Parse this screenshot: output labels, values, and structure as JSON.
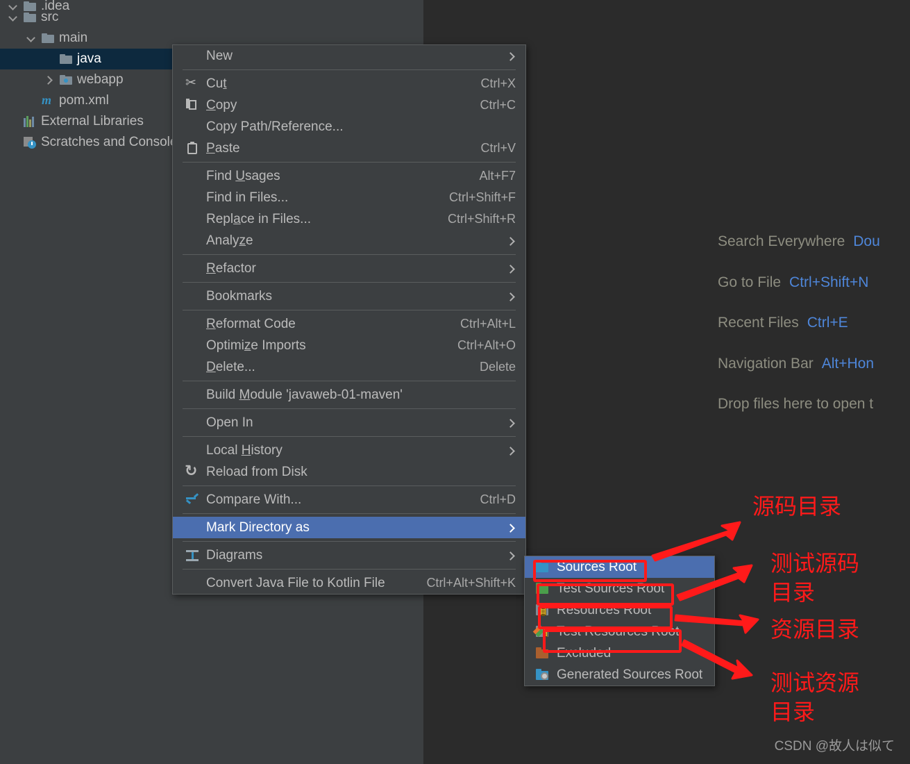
{
  "project_tree": {
    "items": [
      {
        "label": ".idea",
        "indent": 0,
        "chevron": "down",
        "icon": "folder-icon",
        "selected": false,
        "clipped": true
      },
      {
        "label": "src",
        "indent": 0,
        "chevron": "down",
        "icon": "folder-icon",
        "selected": false
      },
      {
        "label": "main",
        "indent": 1,
        "chevron": "down",
        "icon": "folder-icon",
        "selected": false
      },
      {
        "label": "java",
        "indent": 2,
        "chevron": "none",
        "icon": "folder-icon",
        "selected": true
      },
      {
        "label": "webapp",
        "indent": 2,
        "chevron": "right",
        "icon": "webapp-folder-icon",
        "selected": false
      },
      {
        "label": "pom.xml",
        "indent": 1,
        "chevron": "none",
        "icon": "maven-icon",
        "selected": false
      },
      {
        "label": "External Libraries",
        "indent": 0,
        "chevron": "none",
        "icon": "libraries-icon",
        "selected": false
      },
      {
        "label": "Scratches and Consoles",
        "indent": 0,
        "chevron": "none",
        "icon": "scratches-icon",
        "selected": false
      }
    ]
  },
  "editor_hints": [
    {
      "label": "Search Everywhere",
      "shortcut": "Dou"
    },
    {
      "label": "Go to File",
      "shortcut": "Ctrl+Shift+N"
    },
    {
      "label": "Recent Files",
      "shortcut": "Ctrl+E"
    },
    {
      "label": "Navigation Bar",
      "shortcut": "Alt+Hon"
    },
    {
      "label": "Drop files here to open t",
      "shortcut": ""
    }
  ],
  "context_menu": {
    "items": [
      {
        "label": "New",
        "mnemonic": "",
        "accel": "",
        "arrow": true,
        "icon": "",
        "highlighted": false
      },
      {
        "separator": true
      },
      {
        "label": "Cut",
        "mnemonic": "t",
        "accel": "Ctrl+X",
        "arrow": false,
        "icon": "scissors-icon",
        "highlighted": false
      },
      {
        "label": "Copy",
        "mnemonic": "C",
        "accel": "Ctrl+C",
        "arrow": false,
        "icon": "copy-icon",
        "highlighted": false
      },
      {
        "label": "Copy Path/Reference...",
        "mnemonic": "",
        "accel": "",
        "arrow": false,
        "icon": "",
        "highlighted": false
      },
      {
        "label": "Paste",
        "mnemonic": "P",
        "accel": "Ctrl+V",
        "arrow": false,
        "icon": "paste-icon",
        "highlighted": false
      },
      {
        "separator": true
      },
      {
        "label": "Find Usages",
        "mnemonic": "U",
        "accel": "Alt+F7",
        "arrow": false,
        "icon": "",
        "highlighted": false
      },
      {
        "label": "Find in Files...",
        "mnemonic": "",
        "accel": "Ctrl+Shift+F",
        "arrow": false,
        "icon": "",
        "highlighted": false
      },
      {
        "label": "Replace in Files...",
        "mnemonic": "a",
        "accel": "Ctrl+Shift+R",
        "arrow": false,
        "icon": "",
        "highlighted": false
      },
      {
        "label": "Analyze",
        "mnemonic": "z",
        "accel": "",
        "arrow": true,
        "icon": "",
        "highlighted": false
      },
      {
        "separator": true
      },
      {
        "label": "Refactor",
        "mnemonic": "R",
        "accel": "",
        "arrow": true,
        "icon": "",
        "highlighted": false
      },
      {
        "separator": true
      },
      {
        "label": "Bookmarks",
        "mnemonic": "",
        "accel": "",
        "arrow": true,
        "icon": "",
        "highlighted": false
      },
      {
        "separator": true
      },
      {
        "label": "Reformat Code",
        "mnemonic": "R",
        "accel": "Ctrl+Alt+L",
        "arrow": false,
        "icon": "",
        "highlighted": false
      },
      {
        "label": "Optimize Imports",
        "mnemonic": "z",
        "accel": "Ctrl+Alt+O",
        "arrow": false,
        "icon": "",
        "highlighted": false
      },
      {
        "label": "Delete...",
        "mnemonic": "D",
        "accel": "Delete",
        "arrow": false,
        "icon": "",
        "highlighted": false
      },
      {
        "separator": true
      },
      {
        "label": "Build Module 'javaweb-01-maven'",
        "mnemonic": "M",
        "accel": "",
        "arrow": false,
        "icon": "",
        "highlighted": false
      },
      {
        "separator": true
      },
      {
        "label": "Open In",
        "mnemonic": "",
        "accel": "",
        "arrow": true,
        "icon": "",
        "highlighted": false
      },
      {
        "separator": true
      },
      {
        "label": "Local History",
        "mnemonic": "H",
        "accel": "",
        "arrow": true,
        "icon": "",
        "highlighted": false
      },
      {
        "label": "Reload from Disk",
        "mnemonic": "",
        "accel": "",
        "arrow": false,
        "icon": "reload-icon",
        "highlighted": false
      },
      {
        "separator": true
      },
      {
        "label": "Compare With...",
        "mnemonic": "",
        "accel": "Ctrl+D",
        "arrow": false,
        "icon": "compare-icon",
        "highlighted": false
      },
      {
        "separator": true
      },
      {
        "label": "Mark Directory as",
        "mnemonic": "",
        "accel": "",
        "arrow": true,
        "icon": "",
        "highlighted": true
      },
      {
        "separator": true
      },
      {
        "label": "Diagrams",
        "mnemonic": "",
        "accel": "",
        "arrow": true,
        "icon": "diagram-icon",
        "highlighted": false
      },
      {
        "separator": true
      },
      {
        "label": "Convert Java File to Kotlin File",
        "mnemonic": "",
        "accel": "Ctrl+Alt+Shift+K",
        "arrow": false,
        "icon": "",
        "highlighted": false
      }
    ]
  },
  "submenu": {
    "items": [
      {
        "label": "Sources Root",
        "icon": "blue-folder-icon",
        "highlighted": true
      },
      {
        "label": "Test Sources Root",
        "icon": "green-folder-icon",
        "highlighted": false
      },
      {
        "label": "Resources Root",
        "icon": "resources-folder-icon",
        "highlighted": false
      },
      {
        "label": "Test Resources Root",
        "icon": "test-resources-folder-icon",
        "highlighted": false
      },
      {
        "label": "Excluded",
        "icon": "brown-folder-icon",
        "highlighted": false
      },
      {
        "label": "Generated Sources Root",
        "icon": "generated-folder-icon",
        "highlighted": false
      }
    ]
  },
  "annotations": {
    "accent_color": "#FF1A1A",
    "notes": [
      {
        "text": "源码目录"
      },
      {
        "text": "测试源码\n目录"
      },
      {
        "text": "资源目录"
      },
      {
        "text": "测试资源\n目录"
      }
    ]
  },
  "watermark": {
    "text": "CSDN @故人は似て"
  }
}
